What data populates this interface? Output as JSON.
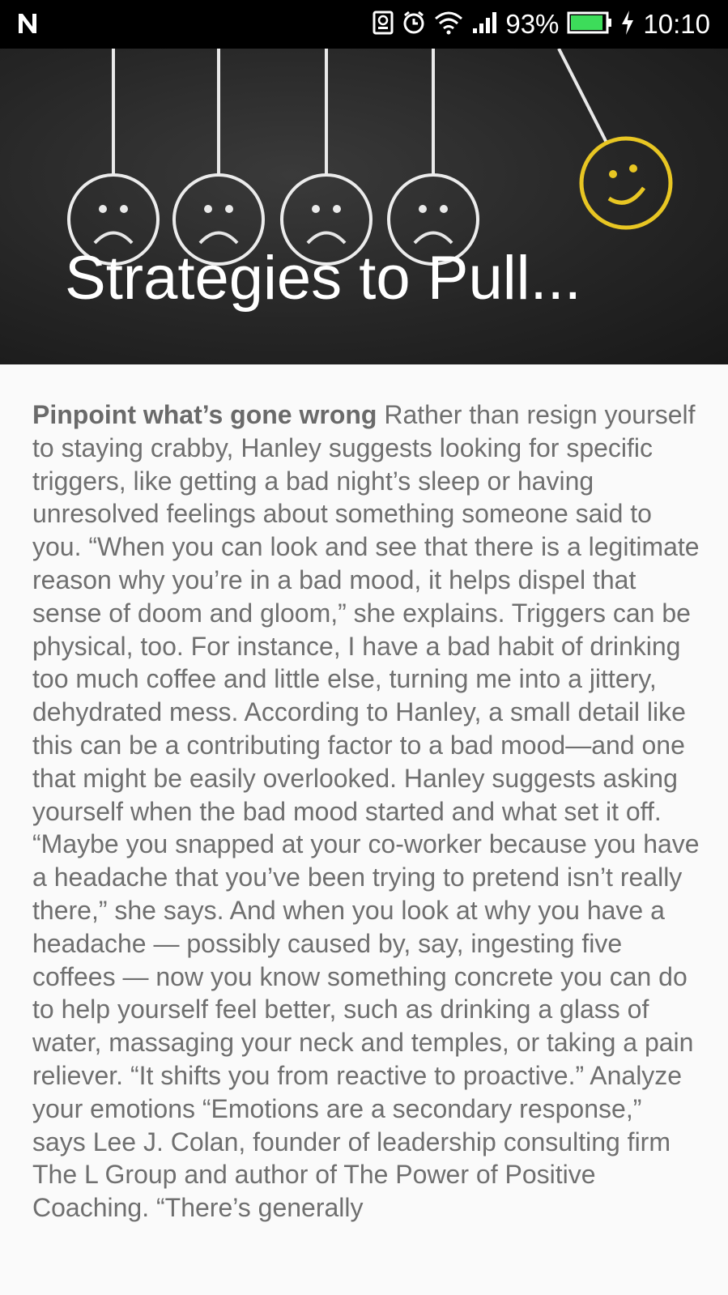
{
  "status_bar": {
    "battery_percent": "93%",
    "time": "10:10",
    "icons": [
      "notification-n-icon",
      "screenshot-icon",
      "alarm-icon",
      "wifi-icon",
      "signal-icon",
      "battery-icon",
      "charging-icon"
    ],
    "battery_color": "#3ddc5a",
    "battery_level": 0.93
  },
  "hero": {
    "title": "Strategies to Pull...",
    "accent_color": "#e8c623"
  },
  "article": {
    "lead": "Pinpoint what’s gone wrong",
    "body": " Rather than resign yourself to staying crabby, Hanley suggests looking for specific triggers, like getting a bad night’s sleep or having unresolved feelings about something someone said to you. “When you can look and see that there is a legitimate reason why you’re in a bad mood, it helps dispel that sense of doom and gloom,” she explains. Triggers can be physical, too. For instance, I have a bad habit of drinking too much coffee and little else, turning me into a jittery, dehydrated mess. According to Hanley, a small detail like this can be a contributing factor to a bad mood—and one that might be easily overlooked. Hanley suggests asking yourself when the bad mood started and what set it off. “Maybe you snapped at your co-worker because you have a headache that you’ve been trying to pretend isn’t really there,” she says. And when you look at why you have a headache — possibly caused by, say, ingesting five coffees — now you know something concrete you can do to help yourself feel better, such as drinking a glass of water, massaging your neck and temples, or taking a pain reliever. “It shifts you from reactive to proactive.” Analyze your emotions “Emotions are a secondary response,” says Lee J. Colan, founder of leadership consulting firm The L Group and author of The Power of Positive Coaching. “There’s generally"
  }
}
